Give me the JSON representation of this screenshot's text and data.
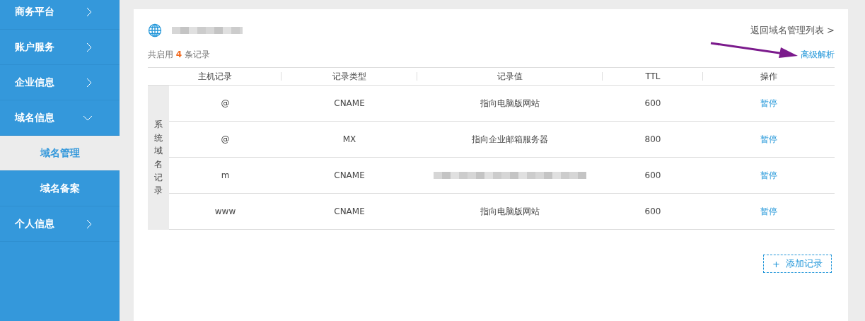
{
  "sidebar": {
    "items": [
      {
        "label": "商务平台",
        "expanded": false
      },
      {
        "label": "账户服务",
        "expanded": false
      },
      {
        "label": "企业信息",
        "expanded": false
      },
      {
        "label": "域名信息",
        "expanded": true,
        "children": [
          {
            "label": "域名管理",
            "selected": true
          },
          {
            "label": "域名备案",
            "selected": false
          }
        ]
      },
      {
        "label": "个人信息",
        "expanded": false
      }
    ]
  },
  "header": {
    "back_link": "返回域名管理列表 >"
  },
  "summary": {
    "prefix": "共启用",
    "count": "4",
    "suffix": "条记录"
  },
  "advanced_link": "高级解析",
  "table": {
    "columns": [
      "主机记录",
      "记录类型",
      "记录值",
      "TTL",
      "操作"
    ],
    "group_label": "系统域名记录",
    "rows": [
      {
        "host": "@",
        "type": "CNAME",
        "value": "指向电脑版网站",
        "ttl": "600",
        "action": "暂停"
      },
      {
        "host": "@",
        "type": "MX",
        "value": "指向企业邮箱服务器",
        "ttl": "800",
        "action": "暂停"
      },
      {
        "host": "m",
        "type": "CNAME",
        "redacted": true,
        "ttl": "600",
        "action": "暂停"
      },
      {
        "host": "www",
        "type": "CNAME",
        "value": "指向电脑版网站",
        "ttl": "600",
        "action": "暂停"
      }
    ]
  },
  "add_button": {
    "icon": "+",
    "label": "添加记录"
  }
}
